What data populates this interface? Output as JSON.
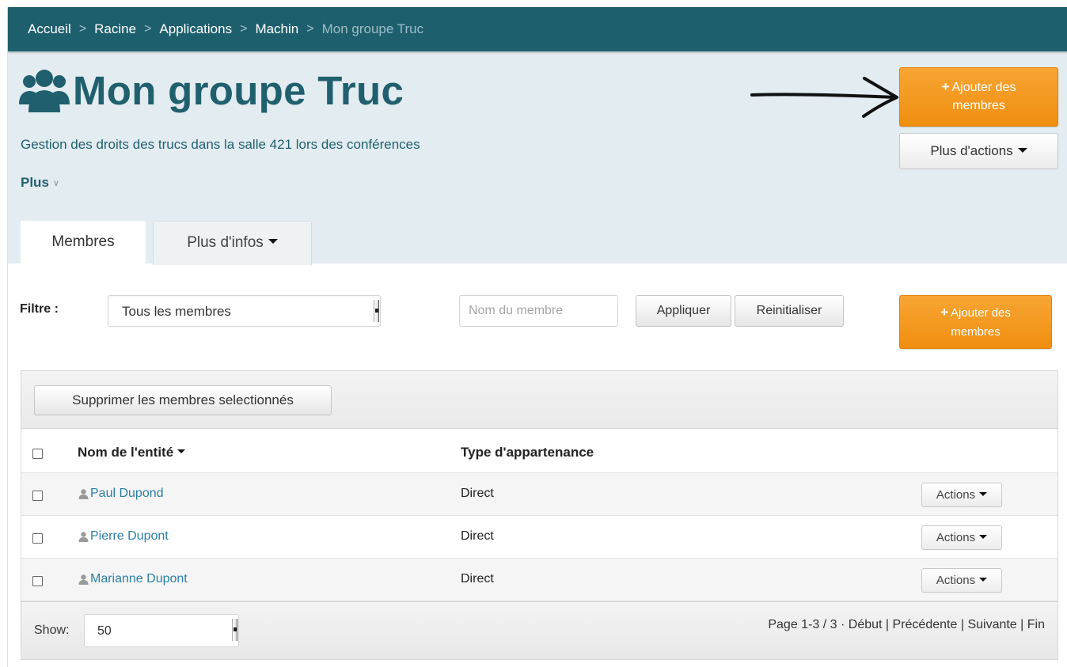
{
  "breadcrumb": {
    "items": [
      "Accueil",
      "Racine",
      "Applications",
      "Machin"
    ],
    "separator": ">",
    "current": "Mon groupe Truc"
  },
  "header": {
    "icon": "users-icon",
    "title": "Mon groupe Truc",
    "subtitle": "Gestion des droits des trucs dans la salle 421 lors des conférences",
    "plus_toggle": "Plus",
    "add_members_button": {
      "icon": "+",
      "line1": "Ajouter des",
      "line2": "membres"
    },
    "more_actions_button": "Plus d'actions"
  },
  "tabs": [
    {
      "label": "Membres",
      "active": true
    },
    {
      "label": "Plus d'infos",
      "active": false
    }
  ],
  "filter": {
    "label": "Filtre :",
    "selected_option": "Tous les membres",
    "name_placeholder": "Nom du membre",
    "name_value": "",
    "apply_button": "Appliquer",
    "reset_button": "Reinitialiser",
    "add_members_button": {
      "icon": "+",
      "line1": "Ajouter des",
      "line2": "membres"
    }
  },
  "table": {
    "delete_button": "Supprimer les membres selectionnés",
    "columns": [
      "Nom de l'entité",
      "Type d'appartenance"
    ],
    "rows": [
      {
        "name": "Paul Dupond",
        "type": "Direct",
        "action": "Actions"
      },
      {
        "name": "Pierre Dupont",
        "type": "Direct",
        "action": "Actions"
      },
      {
        "name": "Marianne Dupont",
        "type": "Direct",
        "action": "Actions"
      }
    ],
    "footer": {
      "show_label": "Show:",
      "show_value": "50",
      "page_info": "Page 1-3 / 3 ·",
      "first": "Début",
      "previous": "Précédente",
      "next": "Suivante",
      "last": "Fin",
      "divider": "|"
    }
  },
  "colors": {
    "breadcrumb_bg": "#1e5f6d",
    "header_bg": "#e3ecf0",
    "title": "#20606e",
    "link": "#2a7fa8",
    "accent_orange": "#f39a1e"
  }
}
